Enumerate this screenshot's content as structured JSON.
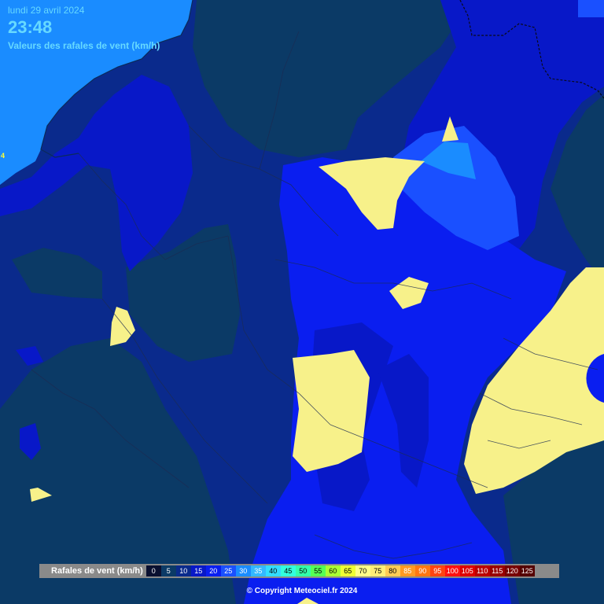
{
  "header": {
    "date": "lundi 29 avril 2024",
    "time": "23:48",
    "subtitle": "Valeurs des rafales de vent (km/h)"
  },
  "edge_label": "4",
  "legend": {
    "title": "Rafales de vent (km/h)",
    "classes": [
      {
        "label": "0",
        "color": "#0a1030",
        "text": "#ffffff"
      },
      {
        "label": "5",
        "color": "#0b3a66",
        "text": "#ffffff"
      },
      {
        "label": "10",
        "color": "#0a2a8c",
        "text": "#ffffff"
      },
      {
        "label": "15",
        "color": "#0818c8",
        "text": "#ffffff"
      },
      {
        "label": "20",
        "color": "#0a1ef0",
        "text": "#ffffff"
      },
      {
        "label": "25",
        "color": "#1a50ff",
        "text": "#ffffff"
      },
      {
        "label": "30",
        "color": "#1a8cff",
        "text": "#ffffff"
      },
      {
        "label": "35",
        "color": "#33b8ff",
        "text": "#ffffff"
      },
      {
        "label": "40",
        "color": "#33ddff",
        "text": "#000000"
      },
      {
        "label": "45",
        "color": "#33ffdd",
        "text": "#000000"
      },
      {
        "label": "50",
        "color": "#33ffaa",
        "text": "#000000"
      },
      {
        "label": "55",
        "color": "#55ff55",
        "text": "#000000"
      },
      {
        "label": "60",
        "color": "#aaff33",
        "text": "#000000"
      },
      {
        "label": "65",
        "color": "#eeff33",
        "text": "#000000"
      },
      {
        "label": "70",
        "color": "#ffff88",
        "text": "#000000"
      },
      {
        "label": "75",
        "color": "#ffee77",
        "text": "#000000"
      },
      {
        "label": "80",
        "color": "#ffcc55",
        "text": "#000000"
      },
      {
        "label": "85",
        "color": "#ff9922",
        "text": "#ffffff"
      },
      {
        "label": "90",
        "color": "#ff7711",
        "text": "#ffffff"
      },
      {
        "label": "95",
        "color": "#ff4411",
        "text": "#ffffff"
      },
      {
        "label": "100",
        "color": "#ff1111",
        "text": "#ffffff"
      },
      {
        "label": "105",
        "color": "#dd0000",
        "text": "#ffffff"
      },
      {
        "label": "110",
        "color": "#bb0000",
        "text": "#ffffff"
      },
      {
        "label": "115",
        "color": "#990000",
        "text": "#ffffff"
      },
      {
        "label": "120",
        "color": "#770000",
        "text": "#ffffff"
      },
      {
        "label": "125",
        "color": "#550000",
        "text": "#ffffff"
      }
    ]
  },
  "copyright": "© Copyright Meteociel.fr 2024"
}
